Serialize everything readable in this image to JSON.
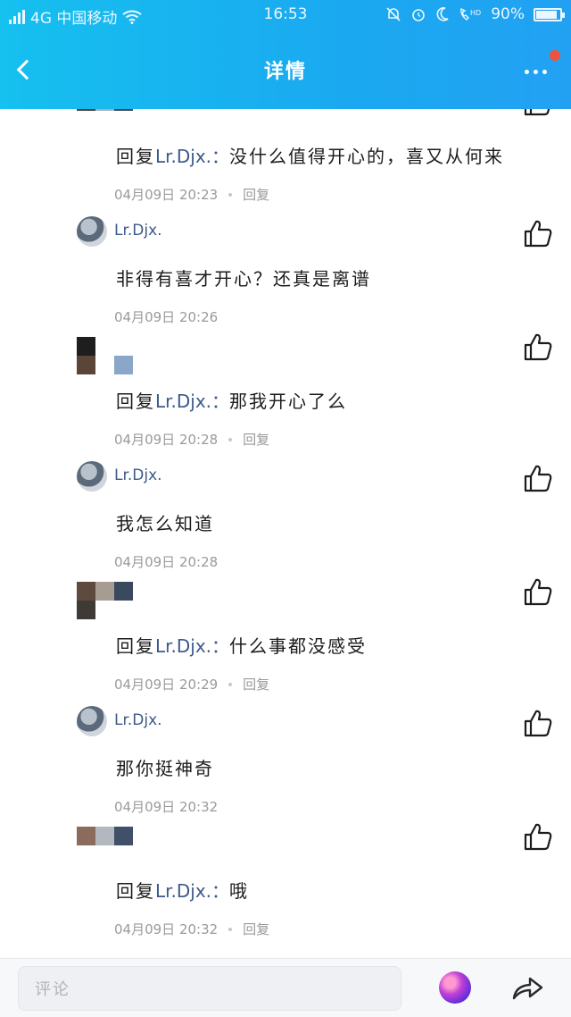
{
  "status_bar": {
    "carrier": "4G 中国移动",
    "time": "16:53",
    "battery": "90%",
    "battery_level": 0.9
  },
  "header": {
    "title": "详情",
    "has_notification": true
  },
  "comments": [
    {
      "type": "reply",
      "reply_prefix": "回复",
      "reply_to": "Lr.Djx.：",
      "text": "没什么值得开心的，喜又从何来",
      "time": "04月09日 20:23",
      "reply_label": "回复",
      "mosaic_colors": [
        "#4d3f35",
        "#a7aeb8",
        "#3c4a5d"
      ]
    },
    {
      "type": "own",
      "username": "Lr.Djx.",
      "text": "非得有喜才开心？还真是离谱",
      "time": "04月09日 20:26"
    },
    {
      "type": "reply",
      "reply_prefix": "回复",
      "reply_to": "Lr.Djx.：",
      "text": "那我开心了么",
      "time": "04月09日 20:28",
      "reply_label": "回复",
      "mosaic_colors": [
        "#1e1e1e",
        "#ffffff",
        "#ffffff",
        "#5a4538",
        "#ffffff",
        "#8aa6c8"
      ]
    },
    {
      "type": "own",
      "username": "Lr.Djx.",
      "text": "我怎么知道",
      "time": "04月09日 20:28"
    },
    {
      "type": "reply",
      "reply_prefix": "回复",
      "reply_to": "Lr.Djx.：",
      "text": "什么事都没感受",
      "time": "04月09日 20:29",
      "reply_label": "回复",
      "mosaic_colors": [
        "#5e4a3e",
        "#a79c92",
        "#3a4a5e",
        "#3e3a36",
        "#ffffff",
        "#ffffff"
      ]
    },
    {
      "type": "own",
      "username": "Lr.Djx.",
      "text": "那你挺神奇",
      "time": "04月09日 20:32"
    },
    {
      "type": "reply",
      "reply_prefix": "回复",
      "reply_to": "Lr.Djx.：",
      "text": "哦",
      "time": "04月09日 20:32",
      "reply_label": "回复",
      "mosaic_colors": [
        "#8a6b5e",
        "#b3b8bf",
        "#3f5068"
      ]
    }
  ],
  "bottom_bar": {
    "comment_placeholder": "评论"
  },
  "icons": {
    "back": "chevron-left-icon",
    "more": "more-dots-icon",
    "like": "thumbs-up-icon",
    "share": "share-arrow-icon"
  },
  "colors": {
    "header": "#1aa9f0",
    "username": "#3c5a8c",
    "meta": "#9a9a9a",
    "notification": "#f2513e"
  }
}
